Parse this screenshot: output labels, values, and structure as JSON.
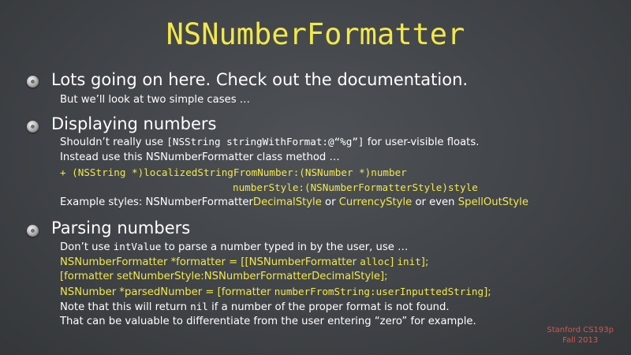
{
  "slide": {
    "title": "NSNumberFormatter",
    "sections": [
      {
        "heading": "Lots going on here.  Check out the documentation.",
        "lines": [
          "But we’ll look at two simple cases …"
        ]
      },
      {
        "heading": "Displaying numbers",
        "line1_pre": "Shouldn’t really use ",
        "line1_code": "[NSString stringWithFormat:@“%g”]",
        "line1_post": " for user-visible floats.",
        "line2": "Instead use this NSNumberFormatter class method …",
        "method_line1": "+ (NSString *)localizedStringFromNumber:(NSNumber *)number",
        "method_line2": "numberStyle:(NSNumberFormatterStyle)style",
        "styles_pre": "Example styles: NSNumberFormatter",
        "style_decimal": "DecimalStyle",
        "styles_or1": " or ",
        "style_currency": "CurrencyStyle",
        "styles_or2": " or even ",
        "style_spellout": "SpellOutStyle"
      },
      {
        "heading": "Parsing numbers",
        "line1_pre": "Don’t use ",
        "line1_code": "intValue",
        "line1_post": " to parse a number typed in by the user, use …",
        "code1_pre": "NSNumberFormatter *formatter = [[NSNumberFormatter ",
        "code1_alloc": "alloc",
        "code1_mid": "] ",
        "code1_init": "init",
        "code1_end": "];",
        "code2": "[formatter setNumberStyle:NSNumberFormatterDecimalStyle];",
        "code3_pre": "NSNumber *parsedNumber = [formatter ",
        "code3_method": "numberFromString:userInputtedString",
        "code3_end": "];",
        "note1_pre": "Note that this will return ",
        "note1_code": "nil",
        "note1_post": " if a number of the proper format is not found.",
        "note2": "That can be valuable to differentiate from the user entering “zero” for example."
      }
    ],
    "footer": {
      "course": "Stanford CS193p",
      "term": "Fall 2013"
    }
  }
}
